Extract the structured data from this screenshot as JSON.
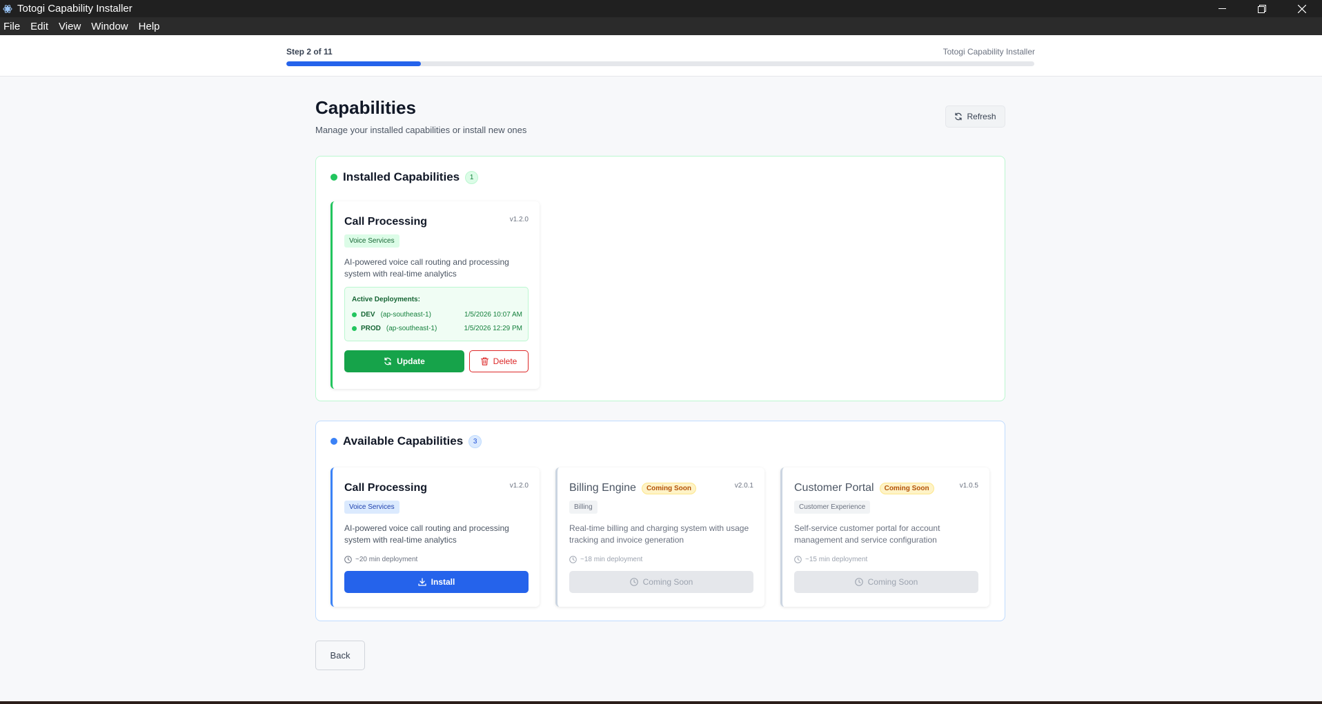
{
  "window": {
    "title": "Totogi Capability Installer"
  },
  "menu": [
    "File",
    "Edit",
    "View",
    "Window",
    "Help"
  ],
  "header": {
    "step_label": "Step 2 of 11",
    "app_name": "Totogi Capability Installer",
    "progress_fraction": 0.18
  },
  "page": {
    "title": "Capabilities",
    "subtitle": "Manage your installed capabilities or install new ones",
    "refresh_label": "Refresh"
  },
  "installed": {
    "title": "Installed Capabilities",
    "count": "1",
    "cards": [
      {
        "name": "Call Processing",
        "version": "v1.2.0",
        "category": "Voice Services",
        "description": "AI-powered voice call routing and processing system with real-time analytics",
        "deployments_label": "Active Deployments:",
        "deployments": [
          {
            "env": "DEV",
            "region": "(ap-southeast-1)",
            "time": "1/5/2026 10:07 AM"
          },
          {
            "env": "PROD",
            "region": "(ap-southeast-1)",
            "time": "1/5/2026 12:29 PM"
          }
        ],
        "update_label": "Update",
        "delete_label": "Delete"
      }
    ]
  },
  "available": {
    "title": "Available Capabilities",
    "count": "3",
    "cards": [
      {
        "name": "Call Processing",
        "version": "v1.2.0",
        "category": "Voice Services",
        "description": "AI-powered voice call routing and processing system with real-time analytics",
        "deployment_time": "~20 min deployment",
        "action_label": "Install"
      },
      {
        "name": "Billing Engine",
        "badge": "Coming Soon",
        "version": "v2.0.1",
        "category": "Billing",
        "description": "Real-time billing and charging system with usage tracking and invoice generation",
        "deployment_time": "~18 min deployment",
        "action_label": "Coming Soon"
      },
      {
        "name": "Customer Portal",
        "badge": "Coming Soon",
        "version": "v1.0.5",
        "category": "Customer Experience",
        "description": "Self-service customer portal for account management and service configuration",
        "deployment_time": "~15 min deployment",
        "action_label": "Coming Soon"
      }
    ]
  },
  "footer": {
    "back_label": "Back"
  },
  "colors": {
    "accent": "#2563eb",
    "success": "#16a34a",
    "danger": "#dc2626",
    "warning": "#b45309"
  },
  "icons": [
    "app-icon",
    "minimize-icon",
    "restore-icon",
    "close-icon",
    "refresh-icon",
    "trash-icon",
    "download-icon",
    "clock-icon"
  ]
}
